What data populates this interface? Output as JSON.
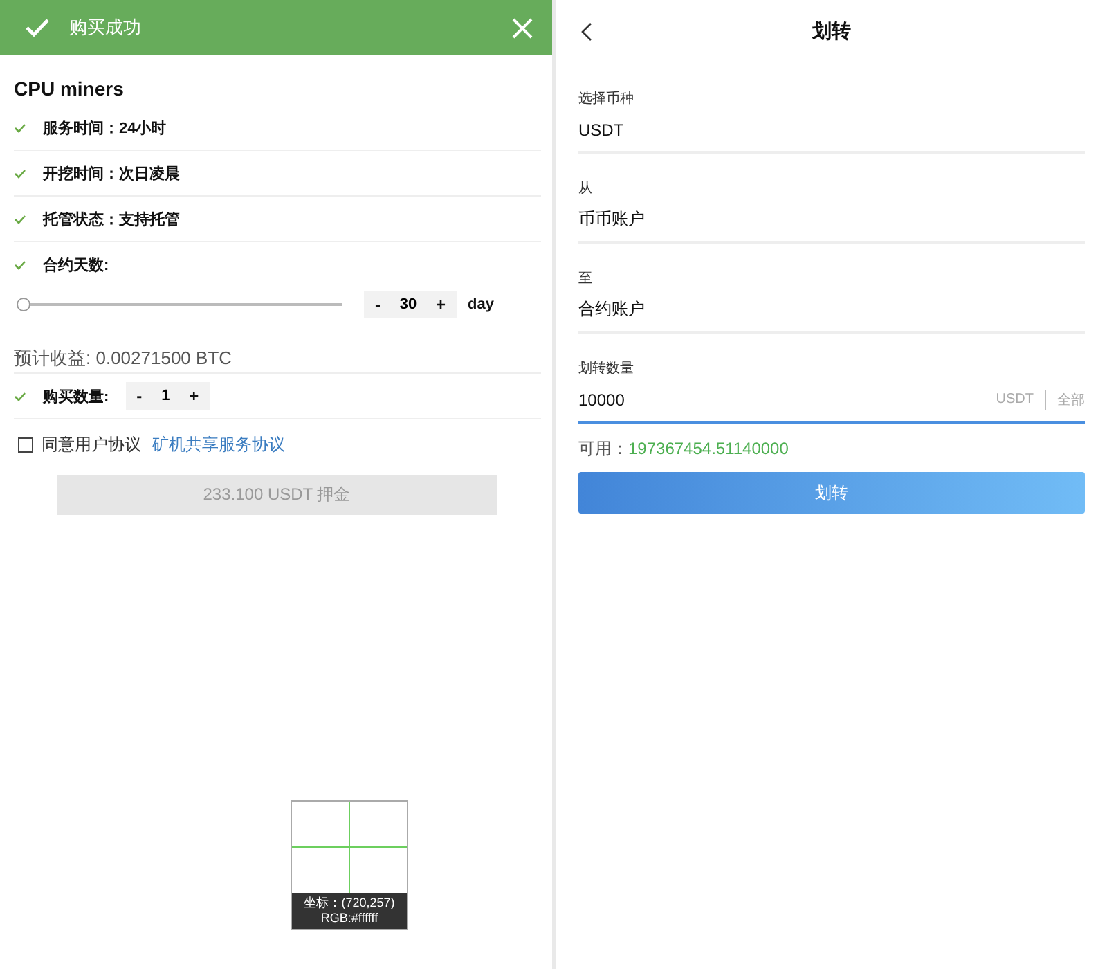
{
  "purchase_panel": {
    "banner": {
      "text": "购买成功"
    },
    "product_title": "CPU miners",
    "features": [
      {
        "text": "服务时间：24小时"
      },
      {
        "text": "开挖时间：次日凌晨"
      },
      {
        "text": "托管状态：支持托管"
      }
    ],
    "contract_days": {
      "label": "合约天数:",
      "slider": {
        "level": 0
      },
      "stepper": {
        "minus": "-",
        "value": "30",
        "plus": "+"
      },
      "unit": "day"
    },
    "estimated_income": "预计收益: 0.00271500 BTC",
    "quantity": {
      "label": "购买数量:",
      "stepper": {
        "minus": "-",
        "value": "1",
        "plus": "+"
      }
    },
    "agreement": {
      "checked": false,
      "label": "同意用户协议",
      "link": "矿机共享服务协议"
    },
    "submit": {
      "label": "233.100 USDT 押金",
      "disabled": true
    }
  },
  "color_picker": {
    "coords": "坐标：(720,257)",
    "rgb": "RGB:#ffffff"
  },
  "transfer_panel": {
    "title": "划转",
    "fields": [
      {
        "label": "选择币种",
        "value": "USDT"
      },
      {
        "label": "从",
        "value": "币币账户"
      },
      {
        "label": "至",
        "value": "合约账户"
      }
    ],
    "amount": {
      "label": "划转数量",
      "value": "10000",
      "focused": true,
      "unit": "USDT",
      "all": "全部"
    },
    "available": {
      "label": "可用：",
      "value": "197367454.51140000"
    },
    "button": "划转"
  }
}
